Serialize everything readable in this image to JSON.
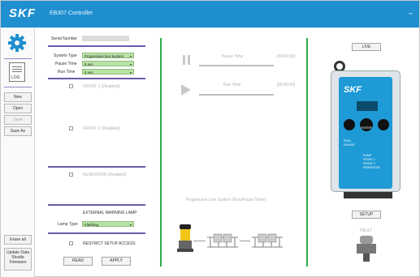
{
  "titlebar": {
    "brand": "SKF",
    "title": "EB307 Controller",
    "minimize": "–"
  },
  "sidebar": {
    "log_label": "LOG",
    "new": "New",
    "open": "Open",
    "save": "Save",
    "save_as": "Save As",
    "erase_all": "Erase all",
    "update": "Update Data Shuttle Firmware"
  },
  "form": {
    "serial_label": "Serial Number",
    "serial_value": "",
    "system_type_label": "System Type",
    "system_type_value": "Progressive line System",
    "pause_time_label": "Pause Time",
    "pause_time_value": "5 sec",
    "run_time_label": "Run Time",
    "run_time_value": "5 sec",
    "front1": "FRONT 1 (Disabled)",
    "front2": "FRONT 2 (Disabled)",
    "reservoir": "RESERVOIR (Disabled)",
    "warning_lamp": "EXTERNAL WARNING LAMP",
    "lamp_type_label": "Lamp Type",
    "lamp_type_value": "Flashing",
    "restrict": "RESTRICT SETUP ACCESS",
    "read": "READ",
    "apply": "APPLY"
  },
  "center": {
    "pause_time_label": "Pause Time",
    "pause_time_value": "[00:00:00]",
    "run_time_label": "Run Time",
    "run_time_value": "[00:00:00]",
    "system_label": "Progressive Line System (Run/Pause Timer)"
  },
  "right": {
    "live": "LIVE",
    "setup": "SETUP",
    "fault": "FAULT",
    "device_brand": "SKF",
    "enter": "ENTER",
    "run_label": "RUN",
    "pause_label": "PAUSE",
    "device_labels": [
      "PUMP",
      "FRONT 1",
      "FRONT 2",
      "RESERVOIR"
    ]
  },
  "colors": {
    "titlebar": "#1f8fd0",
    "accent_green": "#2eaa4a",
    "purple_rule": "#6a5aa8",
    "field_green": "#b9e3a6"
  }
}
